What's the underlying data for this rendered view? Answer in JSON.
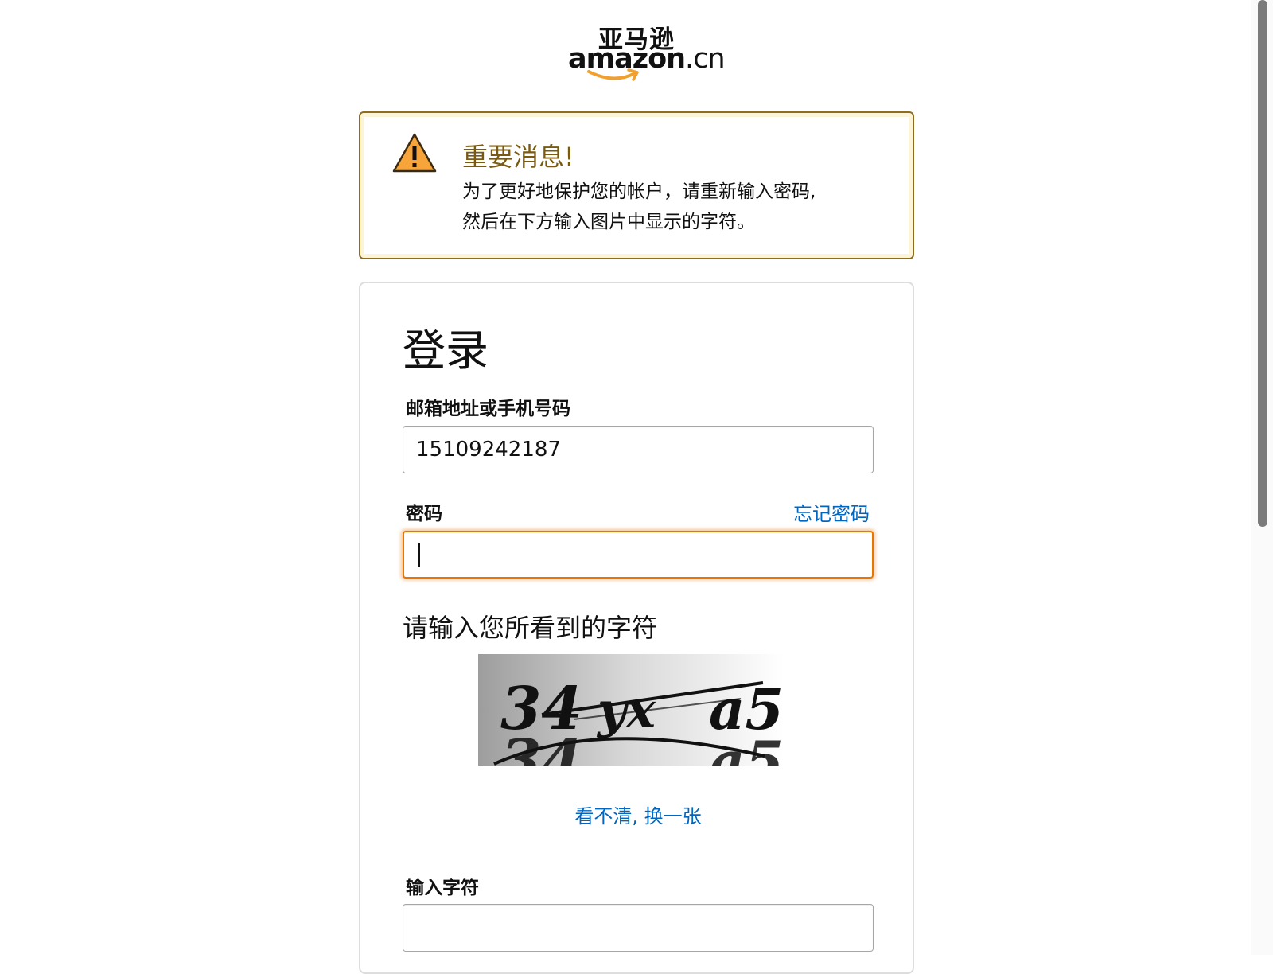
{
  "logo": {
    "cn": "亚马逊",
    "en_main": "amazon",
    "en_tld": ".cn",
    "accent_color": "#f0a02f"
  },
  "alert": {
    "icon": "warning-triangle-icon",
    "title": "重要消息!",
    "line1": "为了更好地保护您的帐户，请重新输入密码,",
    "line2": "然后在下方输入图片中显示的字符。",
    "border_color": "#8d6e20"
  },
  "signin": {
    "title": "登录",
    "email_label": "邮箱地址或手机号码",
    "email_value": "15109242187",
    "password_label": "密码",
    "forgot_link": "忘记密码",
    "password_value": "",
    "captcha_heading": "请输入您所看到的字符",
    "captcha_image": "captcha-image",
    "refresh_link": "看不清, 换一张",
    "captcha_input_label": "输入字符",
    "captcha_input_value": "",
    "link_color": "#0066c0",
    "focus_color": "#e77600"
  }
}
